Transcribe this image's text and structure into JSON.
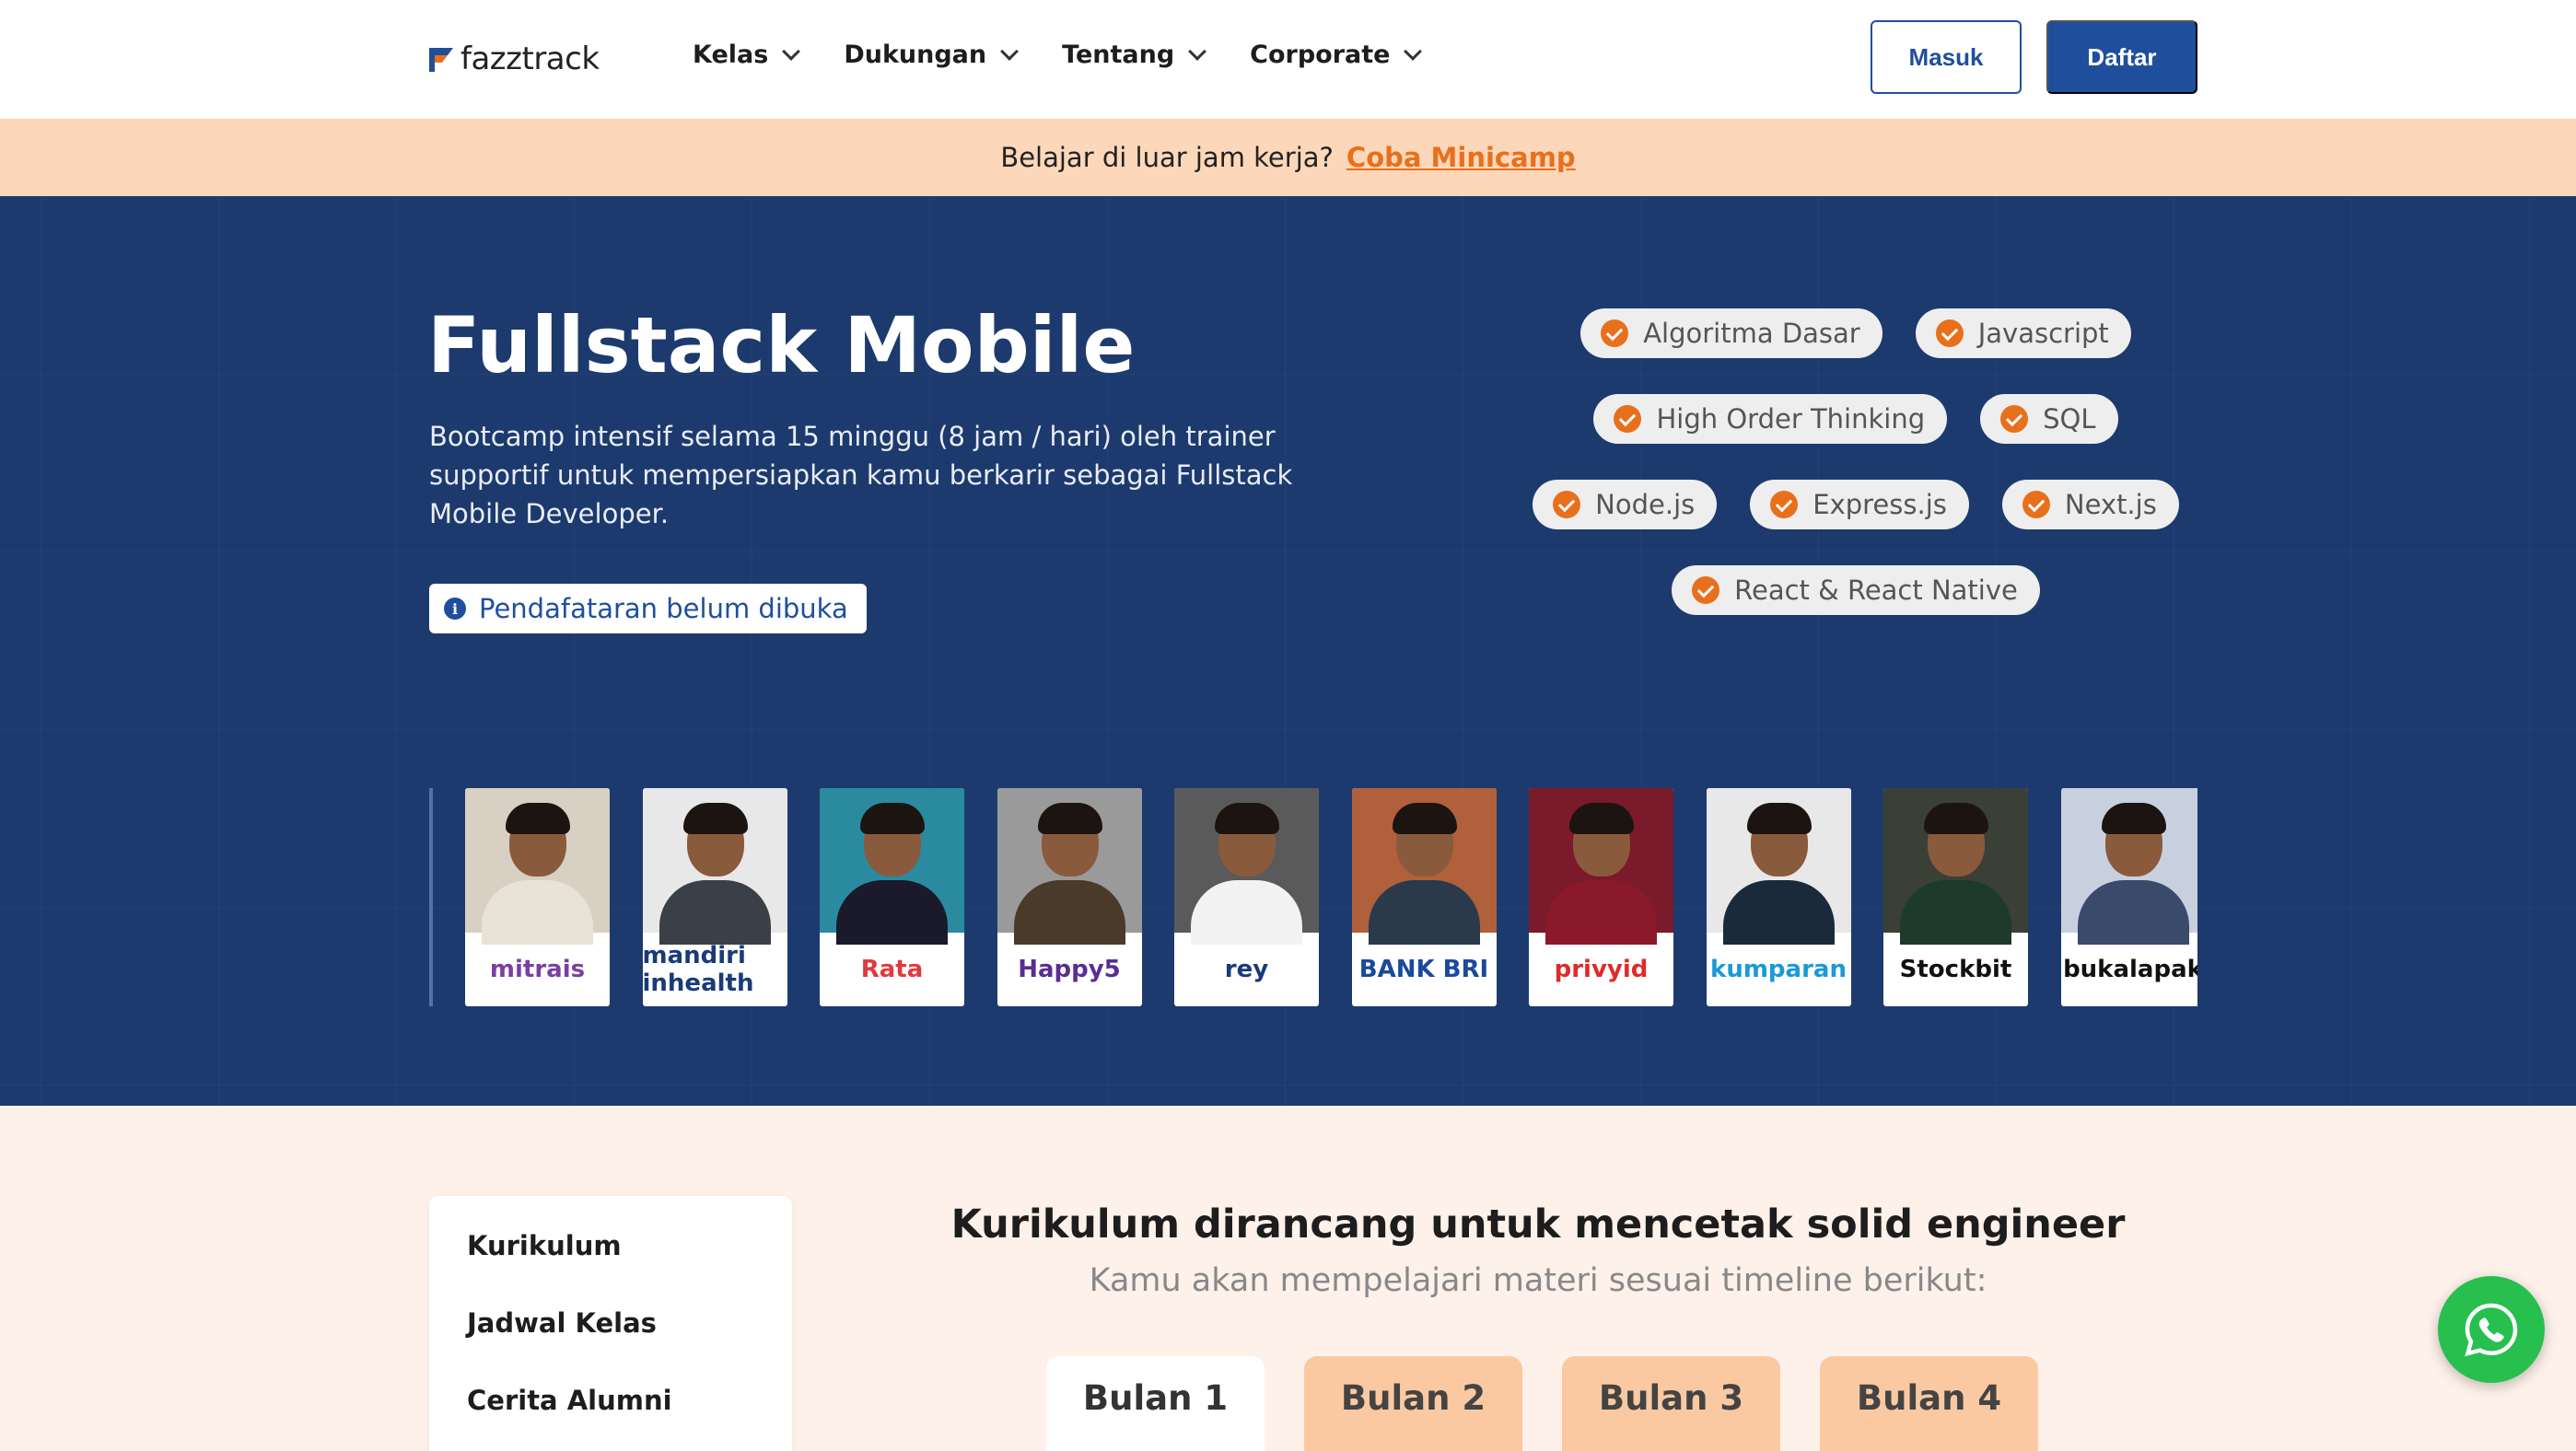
{
  "nav": {
    "logo_text": "fazztrack",
    "menu": [
      {
        "label": "Kelas"
      },
      {
        "label": "Dukungan"
      },
      {
        "label": "Tentang"
      },
      {
        "label": "Corporate"
      }
    ],
    "login_label": "Masuk",
    "register_label": "Daftar",
    "brand_color": "#1f4f9c",
    "accent_color": "#e8701c"
  },
  "promo": {
    "text": "Belajar di luar jam kerja?",
    "link": "Coba Minicamp"
  },
  "hero": {
    "title": "Fullstack Mobile",
    "description": "Bootcamp intensif selama 15 minggu (8 jam / hari) oleh trainer supportif untuk mempersiapkan kamu berkarir sebagai Fullstack Mobile Developer.",
    "registration_status": "Pendafataran belum dibuka",
    "background_color": "#1d3a6e",
    "skills": [
      [
        "Algoritma Dasar",
        "Javascript"
      ],
      [
        "High Order Thinking",
        "SQL"
      ],
      [
        "Node.js",
        "Express.js",
        "Next.js"
      ],
      [
        "React & React Native"
      ]
    ]
  },
  "alumni": [
    {
      "company": "mitrais",
      "color": "#7b3fa0",
      "shirt": "#e9e2d6"
    },
    {
      "company": "mandiri inhealth",
      "color": "#1a3a7a",
      "shirt": "#3b4048"
    },
    {
      "company": "Rata",
      "color": "#e03a3e",
      "shirt": "#1a1a2a"
    },
    {
      "company": "Happy5",
      "color": "#5a2d91",
      "shirt": "#4a3a2a"
    },
    {
      "company": "rey",
      "color": "#1a3a7a",
      "shirt": "#f2f2f2"
    },
    {
      "company": "BANK BRI",
      "color": "#1a4a9a",
      "shirt": "#2a3a4a"
    },
    {
      "company": "privyid",
      "color": "#e02a2a",
      "shirt": "#8a1a2a"
    },
    {
      "company": "kumparan",
      "color": "#1a9ad6",
      "shirt": "#1a2a3a"
    },
    {
      "company": "Stockbit",
      "color": "#111111",
      "shirt": "#1e3a2a"
    },
    {
      "company": "bukalapak",
      "color": "#111111",
      "shirt": "#3a4a6a"
    }
  ],
  "sidenav": {
    "items": [
      "Kurikulum",
      "Jadwal Kelas",
      "Cerita Alumni"
    ]
  },
  "curriculum": {
    "title": "Kurikulum dirancang untuk mencetak solid engineer",
    "subtitle": "Kamu akan mempelajari materi sesuai timeline berikut:",
    "months": [
      "Bulan 1",
      "Bulan 2",
      "Bulan 3",
      "Bulan 4"
    ],
    "active_month": "Bulan 1"
  },
  "whatsapp": {
    "icon": "whatsapp-icon",
    "color": "#27c04f"
  }
}
